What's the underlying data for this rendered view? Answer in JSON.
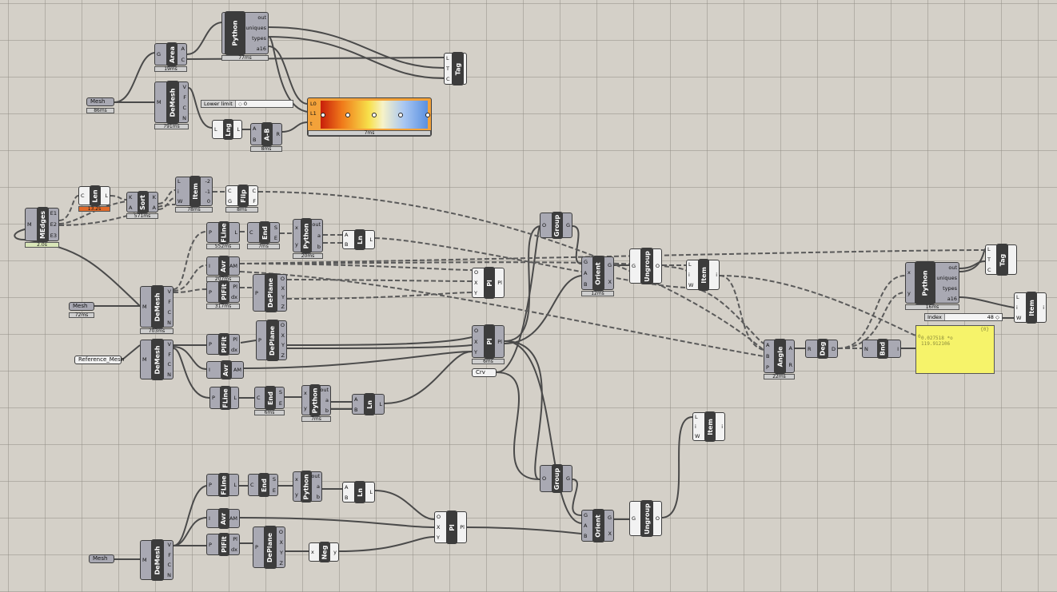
{
  "canvas": {
    "background": "#d4d0c8",
    "grid_color": "#96928a"
  },
  "components": {
    "python1": {
      "name": "Python",
      "outs": [
        "out",
        "uniques",
        "types",
        "a16"
      ],
      "time": "77ms"
    },
    "area": {
      "name": "Area",
      "ins": [
        "G"
      ],
      "outs": [
        "A",
        "C"
      ],
      "time": "19ms"
    },
    "demesh1": {
      "name": "DeMesh",
      "ins": [
        "M"
      ],
      "outs": [
        "V",
        "F",
        "C",
        "N"
      ],
      "time": "791ms"
    },
    "mesh1": {
      "label": "Mesh",
      "time": "86ms"
    },
    "tag1": {
      "name": "Tag",
      "ins": [
        "L",
        "T",
        "C"
      ]
    },
    "lower_limit": {
      "label": "Lower limit",
      "value": "0"
    },
    "gradient": {
      "ins": [
        "L0",
        "L1",
        "t"
      ],
      "time": "7ms"
    },
    "lng": {
      "name": "Lng",
      "ins": [
        "L"
      ],
      "outs": [
        "L"
      ]
    },
    "amb": {
      "name": "A-B",
      "ins": [
        "A",
        "B"
      ],
      "outs": [
        "R"
      ],
      "time": "8ms"
    },
    "len": {
      "name": "Len",
      "ins": [
        "C"
      ],
      "outs": [
        "L"
      ],
      "time": "13.2s"
    },
    "sort": {
      "name": "Sort",
      "ins": [
        "K",
        "A"
      ],
      "outs": [
        "K",
        "A"
      ],
      "time": "571ms"
    },
    "item1": {
      "name": "Item",
      "ins": [
        "L",
        "i",
        "W"
      ],
      "outs": [
        "-2",
        "-1",
        "0"
      ],
      "time": "78ms"
    },
    "flip": {
      "name": "Flip",
      "ins": [
        "C",
        "G"
      ],
      "outs": [
        "C",
        "F"
      ],
      "time": "8ms"
    },
    "medges": {
      "name": "MEdges",
      "ins": [
        "M"
      ],
      "outs": [
        "E1",
        "E2",
        "E3"
      ],
      "time": "2.0s"
    },
    "fline1": {
      "name": "FLine",
      "ins": [
        "P"
      ],
      "outs": [
        "L"
      ],
      "time": "552ms"
    },
    "end1": {
      "name": "End",
      "ins": [
        "C"
      ],
      "outs": [
        "S",
        "E"
      ],
      "time": "7ms"
    },
    "python2": {
      "name": "Python",
      "ins": [
        "x",
        "y"
      ],
      "outs": [
        "out",
        "a",
        "b"
      ],
      "time": "20ms"
    },
    "ln1": {
      "name": "Ln",
      "ins": [
        "A",
        "B"
      ],
      "outs": [
        "L"
      ]
    },
    "avr1": {
      "name": "Avr",
      "ins": [
        "I"
      ],
      "outs": [
        "AM"
      ],
      "time": "207ms"
    },
    "plfit1": {
      "name": "PlFit",
      "ins": [
        "P"
      ],
      "outs": [
        "Pl",
        "dx"
      ],
      "time": "317ms"
    },
    "deplane1": {
      "name": "DePlane",
      "ins": [
        "P"
      ],
      "outs": [
        "O",
        "X",
        "Y",
        "Z"
      ]
    },
    "pl1": {
      "name": "Pl",
      "ins": [
        "O",
        "X",
        "Y"
      ],
      "outs": [
        "Pl"
      ]
    },
    "mesh2": {
      "label": "Mesh",
      "time": "72ms"
    },
    "demesh2": {
      "name": "DeMesh",
      "ins": [
        "M"
      ],
      "outs": [
        "V",
        "F",
        "C",
        "N"
      ],
      "time": "703ms"
    },
    "group1": {
      "name": "Group",
      "ins": [
        "O"
      ],
      "outs": [
        "G"
      ]
    },
    "orient1": {
      "name": "Orient",
      "ins": [
        "G",
        "A",
        "B"
      ],
      "outs": [
        "G",
        "X"
      ],
      "time": "12ms"
    },
    "ungroup1": {
      "name": "Ungroup",
      "ins": [
        "G"
      ],
      "outs": [
        "O"
      ]
    },
    "item2": {
      "name": "Item",
      "ins": [
        "L",
        "i",
        "W"
      ],
      "outs": [
        "i"
      ]
    },
    "ref_mesh": {
      "label": "Reference_Mesh"
    },
    "demesh3": {
      "name": "DeMesh",
      "ins": [
        "M"
      ],
      "outs": [
        "V",
        "F",
        "C",
        "N"
      ]
    },
    "plfit2": {
      "name": "PlFit",
      "ins": [
        "P"
      ],
      "outs": [
        "Pl",
        "dx"
      ]
    },
    "deplane2": {
      "name": "DePlane",
      "ins": [
        "P"
      ],
      "outs": [
        "O",
        "X",
        "Y",
        "Z"
      ]
    },
    "pl2": {
      "name": "Pl",
      "ins": [
        "O",
        "X",
        "Y"
      ],
      "outs": [
        "Pl"
      ],
      "time": "6ms"
    },
    "avr2": {
      "name": "Avr",
      "ins": [
        "I"
      ],
      "outs": [
        "AM"
      ]
    },
    "crv": {
      "label": "Crv"
    },
    "fline2": {
      "name": "FLine",
      "ins": [
        "P"
      ],
      "outs": [
        "L"
      ]
    },
    "end2": {
      "name": "End",
      "ins": [
        "C"
      ],
      "outs": [
        "S",
        "E"
      ],
      "time": "6ms"
    },
    "python3": {
      "name": "Python",
      "ins": [
        "x",
        "y"
      ],
      "outs": [
        "out",
        "a",
        "b"
      ],
      "time": "7ms"
    },
    "ln2": {
      "name": "Ln",
      "ins": [
        "A",
        "B"
      ],
      "outs": [
        "L"
      ]
    },
    "angle": {
      "name": "Angle",
      "ins": [
        "A",
        "B",
        "P"
      ],
      "outs": [
        "A",
        "R"
      ],
      "time": "22ms"
    },
    "deg": {
      "name": "Deg",
      "ins": [
        "R"
      ],
      "outs": [
        "D"
      ]
    },
    "bnd": {
      "name": "Bnd",
      "ins": [
        "N"
      ],
      "outs": [
        "I"
      ]
    },
    "panel": {
      "header": "{0}",
      "lines": [
        "0.027518 *o",
        "119.912106"
      ],
      "prefix": "0"
    },
    "python4": {
      "name": "Python",
      "ins": [
        "x",
        "y"
      ],
      "outs": [
        "out",
        "uniques",
        "types",
        "a16"
      ],
      "time": "16ms"
    },
    "tag2": {
      "name": "Tag",
      "ins": [
        "L",
        "T",
        "C"
      ]
    },
    "item3": {
      "name": "Item",
      "ins": [
        "L",
        "i",
        "W"
      ],
      "outs": [
        "i"
      ]
    },
    "index_slider": {
      "label": "Index",
      "value": "48"
    },
    "item4": {
      "name": "Item",
      "ins": [
        "L",
        "i",
        "W"
      ],
      "outs": [
        "i"
      ]
    },
    "group2": {
      "name": "Group",
      "ins": [
        "O"
      ],
      "outs": [
        "G"
      ]
    },
    "fline3": {
      "name": "FLine",
      "ins": [
        "P"
      ],
      "outs": [
        "L"
      ]
    },
    "end3": {
      "name": "End",
      "ins": [
        "C"
      ],
      "outs": [
        "S",
        "E"
      ]
    },
    "python5": {
      "name": "Python",
      "ins": [
        "x",
        "y"
      ],
      "outs": [
        "out",
        "a",
        "b"
      ]
    },
    "ln3": {
      "name": "Ln",
      "ins": [
        "A",
        "B"
      ],
      "outs": [
        "L"
      ]
    },
    "avr3": {
      "name": "Avr",
      "ins": [
        "I"
      ],
      "outs": [
        "AM"
      ]
    },
    "pl3": {
      "name": "Pl",
      "ins": [
        "O",
        "X",
        "Y"
      ],
      "outs": [
        "Pl"
      ]
    },
    "orient2": {
      "name": "Orient",
      "ins": [
        "G",
        "A",
        "B"
      ],
      "outs": [
        "G",
        "X"
      ]
    },
    "ungroup2": {
      "name": "Ungroup",
      "ins": [
        "G"
      ],
      "outs": [
        "O"
      ]
    },
    "plfit3": {
      "name": "PlFit",
      "ins": [
        "P"
      ],
      "outs": [
        "Pl",
        "dx"
      ]
    },
    "deplane3": {
      "name": "DePlane",
      "ins": [
        "P"
      ],
      "outs": [
        "O",
        "X",
        "Y",
        "Z"
      ]
    },
    "neg": {
      "name": "Neg",
      "ins": [
        "x"
      ],
      "outs": [
        "y"
      ]
    },
    "mesh3": {
      "label": "Mesh"
    },
    "demesh4": {
      "name": "DeMesh",
      "ins": [
        "M"
      ],
      "outs": [
        "V",
        "F",
        "C",
        "N"
      ]
    }
  }
}
